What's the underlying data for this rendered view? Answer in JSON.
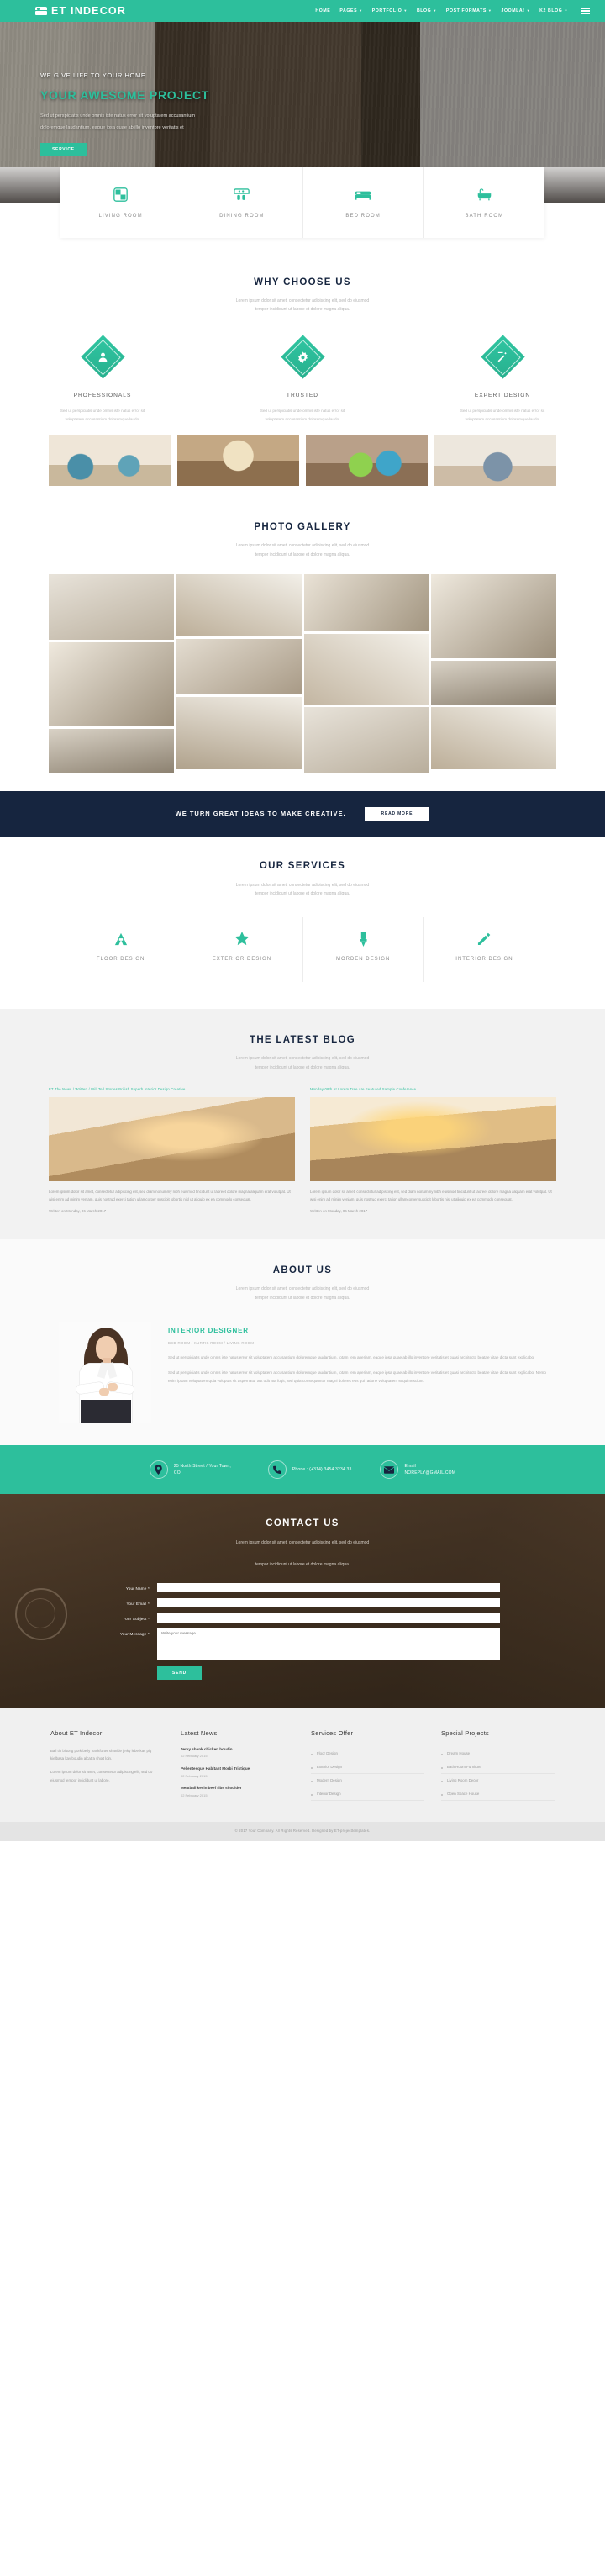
{
  "header": {
    "brand": "ET INDECOR",
    "brand_icon": "bed-icon",
    "nav": [
      {
        "label": "HOME",
        "caret": false
      },
      {
        "label": "PAGES",
        "caret": true
      },
      {
        "label": "PORTFOLIO",
        "caret": true
      },
      {
        "label": "BLOG",
        "caret": true
      },
      {
        "label": "POST FORMATS",
        "caret": true
      },
      {
        "label": "JOOMLA!",
        "caret": true
      },
      {
        "label": "K2 BLOG",
        "caret": true
      }
    ],
    "menu_icon": "hamburger-icon"
  },
  "hero": {
    "subtitle": "WE GIVE LIFE TO YOUR HOME",
    "title": "YOUR AWESOME PROJECT",
    "text": "Sed ut perspiciatis unde omnis iste natus error sit voluptatem accusantium doloremque laudantium, eaque ipsa quae ab illo inventore veritatis et",
    "button": "SERVICE"
  },
  "rooms": [
    {
      "label": "LIVING ROOM",
      "icon": "four-squares-icon"
    },
    {
      "label": "DINING ROOM",
      "icon": "dining-table-icon"
    },
    {
      "label": "BED ROOM",
      "icon": "bed-icon"
    },
    {
      "label": "BATH ROOM",
      "icon": "bathtub-icon"
    }
  ],
  "why": {
    "title": "WHY CHOOSE US",
    "desc_line1": "Lorem ipsum dolor sit amet, consectetur adipiscing elit, sed do eiusmod",
    "desc_line2": "tempor incididunt ut labore et dolore magna aliqua.",
    "items": [
      {
        "name": "PROFESSIONALS",
        "icon": "user-icon",
        "line1": "Sed ut perspiciatis unde omnis iste natus error sit",
        "line2": "voluptatem accusantium doloremque laudo."
      },
      {
        "name": "TRUSTED",
        "icon": "gear-icon",
        "line1": "Sed ut perspiciatis unde omnis iste natus error sit",
        "line2": "voluptatem accusantium doloremque laudo."
      },
      {
        "name": "EXPERT DESIGN",
        "icon": "edit-icon",
        "line1": "Sed ut perspiciatis unde omnis iste natus error sit",
        "line2": "voluptatem accusantium doloremque laudo."
      }
    ]
  },
  "gallery": {
    "title": "PHOTO GALLERY",
    "desc_line1": "Lorem ipsum dolor sit amet, consectetur adipiscing elit, sed do eiusmod",
    "desc_line2": "tempor incididunt ut labore et dolore magna aliqua."
  },
  "cta": {
    "text": "WE TURN GREAT IDEAS TO MAKE CREATIVE.",
    "button": "READ MORE"
  },
  "services": {
    "title": "OUR SERVICES",
    "desc_line1": "Lorem ipsum dolor sit amet, consectetur adipiscing elit, sed do eiusmod",
    "desc_line2": "tempor incididunt ut labore et dolore magna aliqua.",
    "items": [
      {
        "label": "FLOOR DESIGN",
        "icon": "floor-icon"
      },
      {
        "label": "EXTERIOR DESIGN",
        "icon": "star-icon"
      },
      {
        "label": "MORDEN DESIGN",
        "icon": "brush-icon"
      },
      {
        "label": "INTERIOR DESIGN",
        "icon": "pencil-icon"
      }
    ]
  },
  "blog": {
    "title": "THE LATEST BLOG",
    "desc_line1": "Lorem ipsum dolor sit amet, consectetur adipiscing elit, sed do eiusmod",
    "desc_line2": "tempor incididunt ut labore et dolore magna aliqua.",
    "posts": [
      {
        "meta": "ET The News / Written / Will Tell Stories British Superb Interior Design Creative",
        "text": "Lorem ipsum dolor sit amet, consectetur adipiscing elit, sed diam nonummy nibh euismod tincidunt ut laoreet dolore magna aliquam erat volutpat. Ut wisi enim ad minim veniam, quis nostrud exerci tation ullamcorper suscipit lobortis nisl ut aliquip ex ea commodo consequat.",
        "date": "Written on Monday, 06 March 2017"
      },
      {
        "meta": "Monday 08th At Lorem Tree are Featured Sample Conference",
        "text": "Lorem ipsum dolor sit amet, consectetur adipiscing elit, sed diam nonummy nibh euismod tincidunt ut laoreet dolore magna aliquam erat volutpat. Ut wisi enim ad minim veniam, quis nostrud exerci tation ullamcorper suscipit lobortis nisl ut aliquip ex ea commodo consequat.",
        "date": "Written on Monday, 06 March 2017"
      }
    ]
  },
  "about": {
    "title": "ABOUT US",
    "desc_line1": "Lorem ipsum dolor sit amet, consectetur adipiscing elit, sed do eiusmod",
    "desc_line2": "tempor incididunt ut labore et dolore magna aliqua.",
    "person_name": "INTERIOR DESIGNER",
    "person_role": "BED ROOM / KURTIS ROOM / LIVING ROOM",
    "para1": "Sed ut perspiciatis unde omnis iste natus error sit voluptatem accusantium doloremque laudantium, totam rem aperiam, eaque ipsa quae ab illo inventore veritatis et quasi architecto beatae vitae dicta sunt explicabo.",
    "para2": "Sed ut perspiciatis unde omnis iste natus error sit voluptatem accusantium doloremque laudantium, totam rem aperiam, eaque ipsa quae ab illo inventore veritatis et quasi architecto beatae vitae dicta sunt explicabo. Nemo enim ipsam voluptatem quia voluptas sit aspernatur aut odit aut fugit, sed quia consequuntur magni dolores eos qui ratione voluptatem sequi nesciunt."
  },
  "infobar": {
    "address_icon": "location-pin-icon",
    "address": "25 North Street / Your Town, CO.",
    "phone_icon": "phone-icon",
    "phone": "Phone : (+314) 3454 3234 33",
    "email_icon": "envelope-icon",
    "email_label": "Email :",
    "email": "NOREPLY@GMAIL.COM"
  },
  "contact": {
    "title": "CONTACT US",
    "desc_line1": "Lorem ipsum dolor sit amet, consectetur adipiscing elit, sed do eiusmod",
    "desc_line2": "tempor incididunt ut labore et dolore magna aliqua.",
    "fields": [
      {
        "label": "Your Name *",
        "value": "",
        "placeholder": ""
      },
      {
        "label": "Your Email *",
        "value": "",
        "placeholder": ""
      },
      {
        "label": "Your Subject *",
        "value": "",
        "placeholder": ""
      }
    ],
    "message_label": "Your Message *",
    "message_placeholder": "Write your message",
    "submit": "SEND"
  },
  "footer": {
    "col1": {
      "title": "About ET Indecor",
      "text1": "Ball tip biltong pork belly frankfurter shankle jerky leberkas pig kielbasa kay boudin alcatra short loin.",
      "text2": "Lorem ipsum dolor sit amet, consectetur adipiscing elit, sed do eiusmod tempor incididunt ut labore."
    },
    "col2": {
      "title": "Latest News",
      "items": [
        {
          "title": "Jerky shank chicken boudin",
          "date": "02 February 2015"
        },
        {
          "title": "Pellentesque Habitant Morbi Tristique",
          "date": "02 February 2015"
        },
        {
          "title": "Meatball kevin beef ribs shoulder",
          "date": "02 February 2015"
        }
      ]
    },
    "col3": {
      "title": "Services Offer",
      "items": [
        "Floor Design",
        "Exterior Design",
        "Modern Design",
        "Interior Design"
      ]
    },
    "col4": {
      "title": "Special Projects",
      "items": [
        "Dream House",
        "Bath Room Furniture",
        "Living Room Decor",
        "Open Space House"
      ]
    }
  },
  "copyright": "© 2017 Your Company. All Rights Reserved. Designed by ET-projecttemplates."
}
